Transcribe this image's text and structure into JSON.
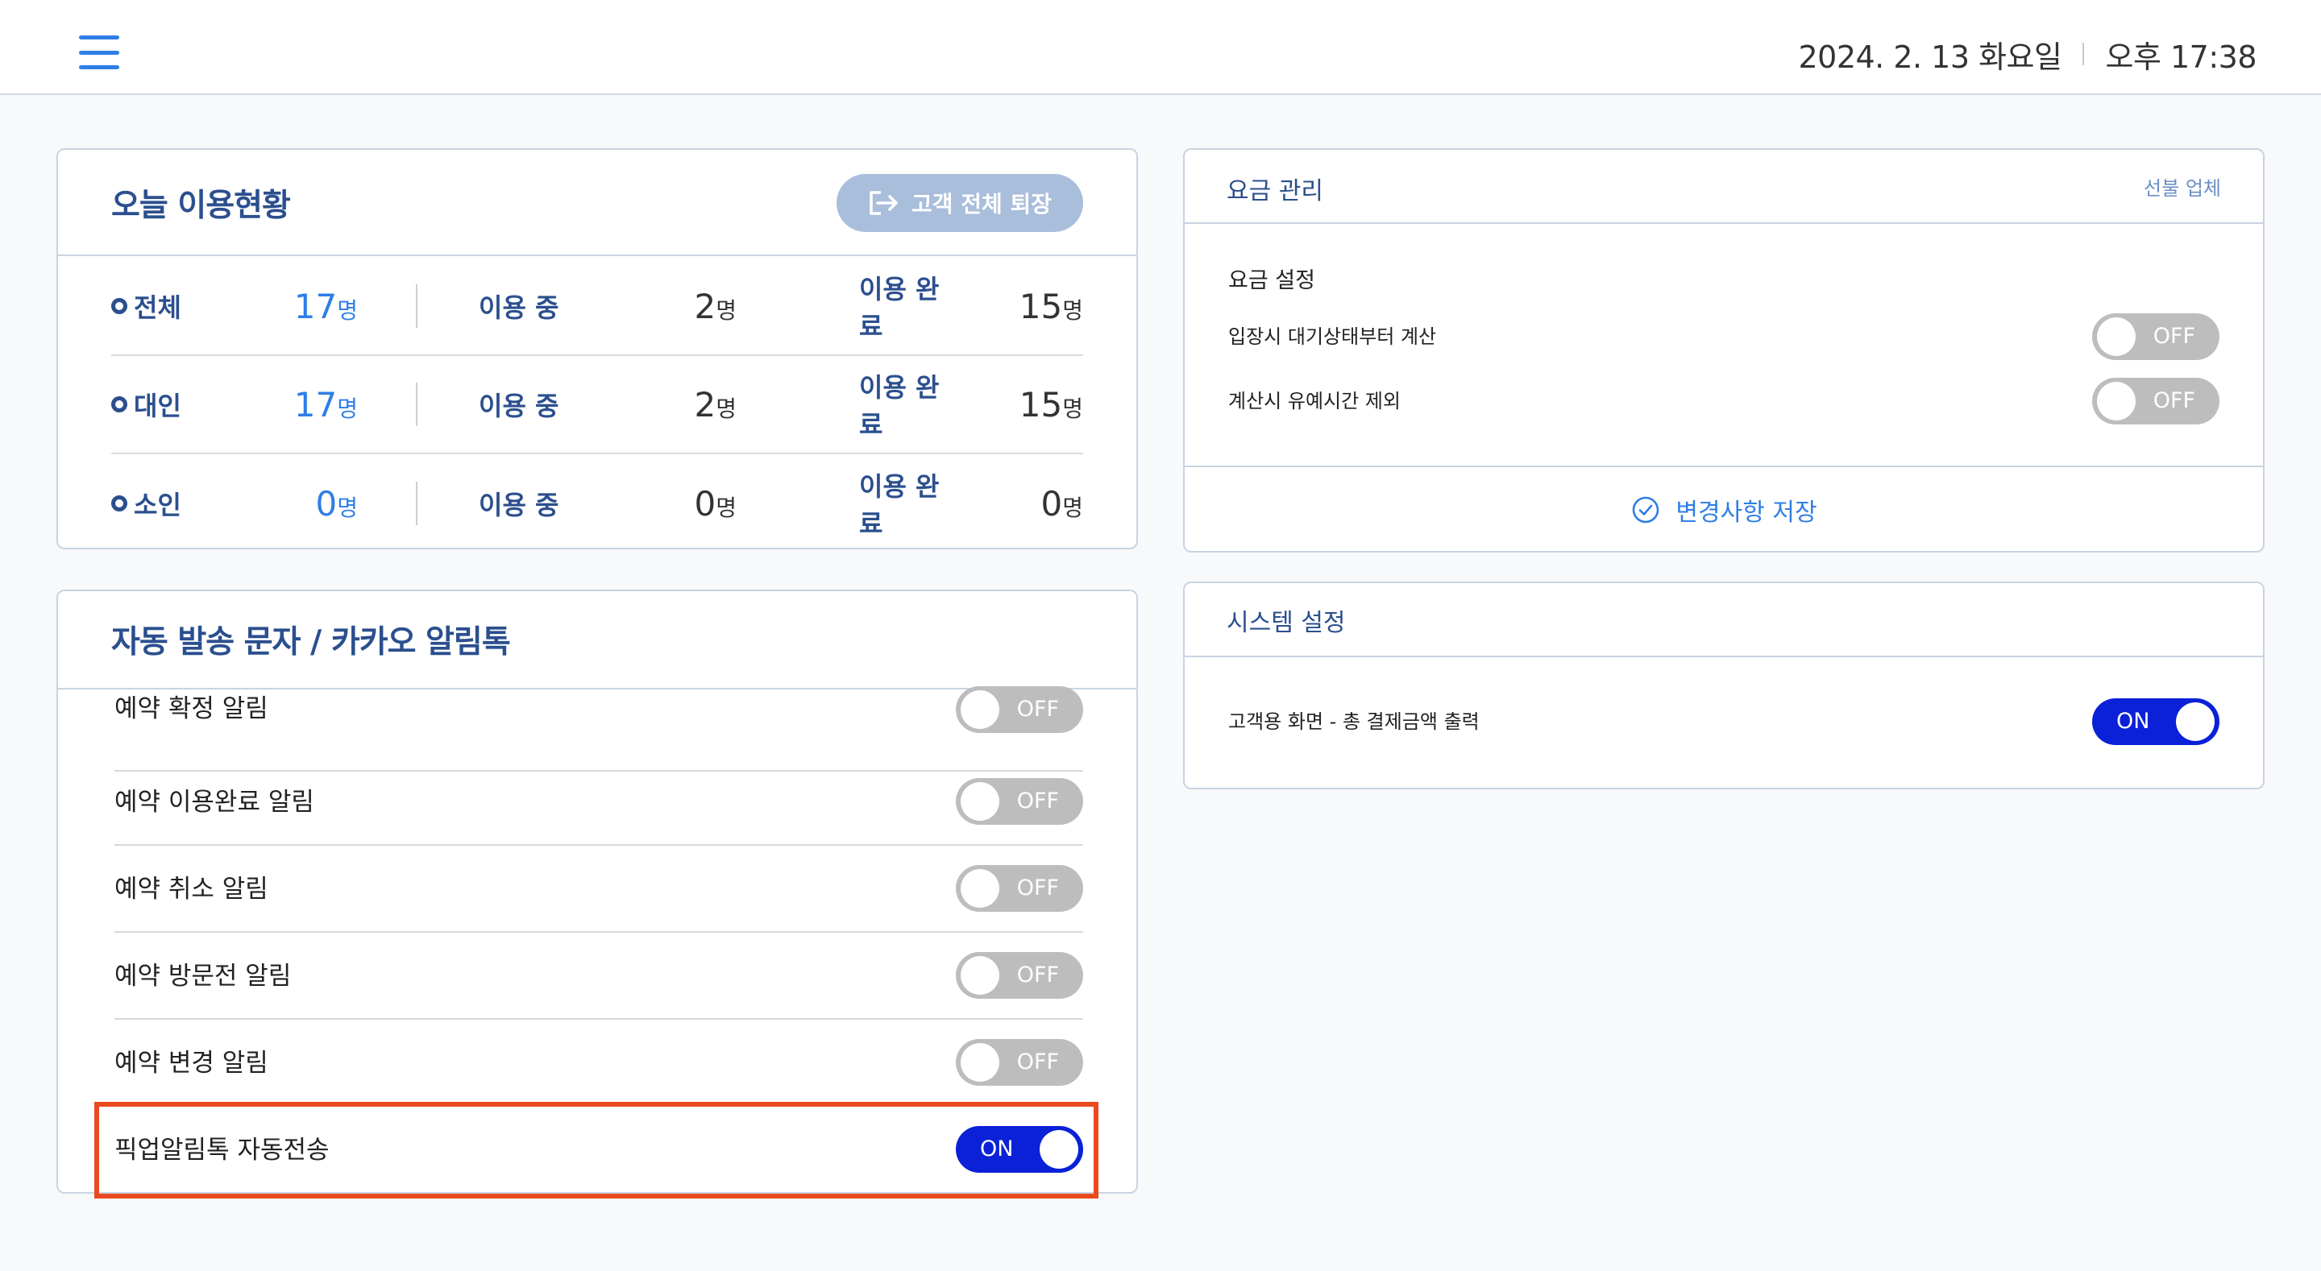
{
  "header": {
    "date": "2024. 2. 13 화요일",
    "time": "오후 17:38"
  },
  "usage": {
    "title": "오늘 이용현황",
    "exit_button": "고객 전체 퇴장",
    "using_label": "이용 중",
    "done_label": "이용 완료",
    "unit": "명",
    "rows": [
      {
        "category": "전체",
        "total": "17",
        "using": "2",
        "done": "15"
      },
      {
        "category": "대인",
        "total": "17",
        "using": "2",
        "done": "15"
      },
      {
        "category": "소인",
        "total": "0",
        "using": "0",
        "done": "0"
      }
    ]
  },
  "messages": {
    "title": "자동 발송 문자 / 카카오 알림톡",
    "items": [
      {
        "label": "예약 확정 알림",
        "state": "OFF"
      },
      {
        "label": "예약 이용완료 알림",
        "state": "OFF"
      },
      {
        "label": "예약 취소 알림",
        "state": "OFF"
      },
      {
        "label": "예약 방문전 알림",
        "state": "OFF"
      },
      {
        "label": "예약 변경 알림",
        "state": "OFF"
      },
      {
        "label": "픽업알림톡 자동전송",
        "state": "ON"
      }
    ]
  },
  "fee": {
    "title": "요금 관리",
    "prepaid": "선불 업체",
    "subtitle": "요금 설정",
    "items": [
      {
        "label": "입장시 대기상태부터 계산",
        "state": "OFF"
      },
      {
        "label": "계산시 유예시간 제외",
        "state": "OFF"
      }
    ],
    "save_button": "변경사항 저장"
  },
  "system": {
    "title": "시스템 설정",
    "items": [
      {
        "label": "고객용 화면 - 총 결제금액 출력",
        "state": "ON"
      }
    ]
  },
  "colors": {
    "accent": "#2f7ee6",
    "title": "#2b4f8e",
    "toggle_on": "#0a21d8",
    "toggle_off": "#bdbdbd",
    "highlight": "#ea4a1f"
  }
}
